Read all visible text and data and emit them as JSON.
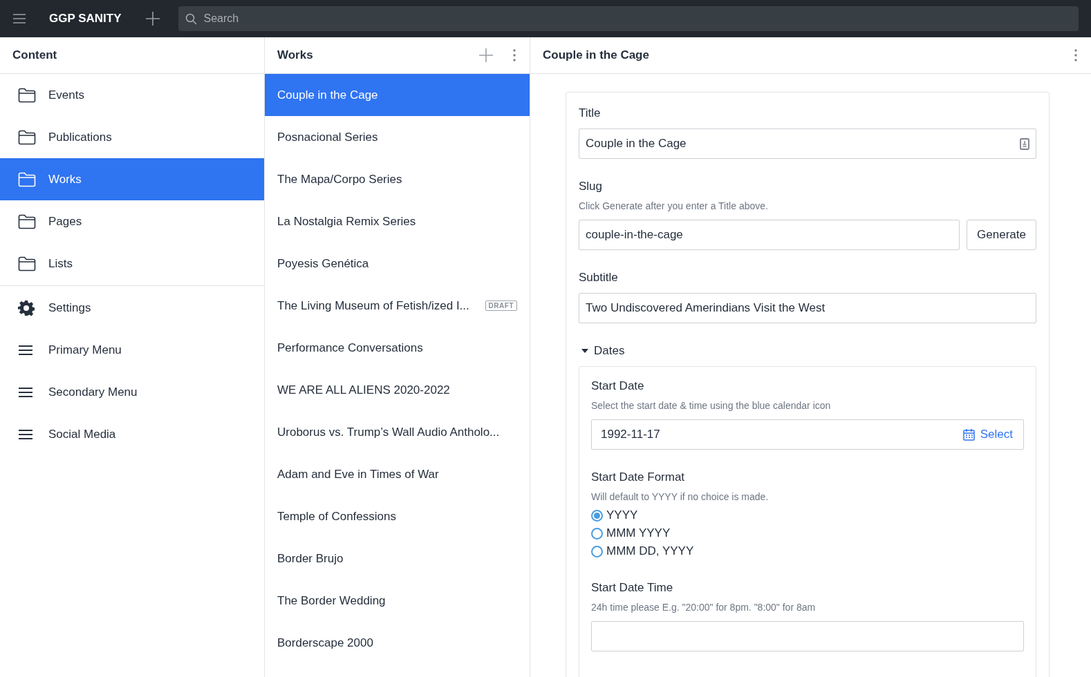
{
  "topbar": {
    "brand": "GGP SANITY",
    "search": {
      "placeholder": "Search"
    }
  },
  "content_pane": {
    "title": "Content",
    "groups": [
      {
        "items": [
          {
            "kind": "folder",
            "label": "Events",
            "selected": false
          },
          {
            "kind": "folder",
            "label": "Publications",
            "selected": false
          },
          {
            "kind": "folder",
            "label": "Works",
            "selected": true
          },
          {
            "kind": "folder",
            "label": "Pages",
            "selected": false
          },
          {
            "kind": "folder",
            "label": "Lists",
            "selected": false
          }
        ]
      },
      {
        "items": [
          {
            "kind": "gear",
            "label": "Settings",
            "selected": false
          },
          {
            "kind": "list",
            "label": "Primary Menu",
            "selected": false
          },
          {
            "kind": "list",
            "label": "Secondary Menu",
            "selected": false
          },
          {
            "kind": "list",
            "label": "Social Media",
            "selected": false
          }
        ]
      }
    ]
  },
  "works_pane": {
    "title": "Works",
    "items": [
      {
        "label": "Couple in the Cage",
        "selected": true
      },
      {
        "label": "Posnacional Series",
        "selected": false
      },
      {
        "label": "The Mapa/Corpo Series",
        "selected": false
      },
      {
        "label": "La Nostalgia Remix Series",
        "selected": false
      },
      {
        "label": "Poyesis Genética",
        "selected": false
      },
      {
        "label": "The Living Museum of Fetish/ized I...",
        "selected": false,
        "badge": "DRAFT"
      },
      {
        "label": "Performance Conversations",
        "selected": false
      },
      {
        "label": "WE ARE ALL ALIENS 2020-2022",
        "selected": false
      },
      {
        "label": "Uroborus vs. Trump’s Wall Audio Antholo...",
        "selected": false
      },
      {
        "label": "Adam and Eve in Times of War",
        "selected": false
      },
      {
        "label": "Temple of Confessions",
        "selected": false
      },
      {
        "label": "Border Brujo",
        "selected": false
      },
      {
        "label": "The Border Wedding",
        "selected": false
      },
      {
        "label": "Borderscape 2000",
        "selected": false
      }
    ]
  },
  "document": {
    "title": "Couple in the Cage",
    "fields": [
      {
        "kind": "title",
        "label": "Title",
        "value": "Couple in the Cage"
      },
      {
        "kind": "slug",
        "label": "Slug",
        "description": "Click Generate after you enter a Title above.",
        "value": "couple-in-the-cage",
        "button": "Generate"
      },
      {
        "kind": "text",
        "label": "Subtitle",
        "value": "Two Undiscovered Amerindians Visit the West"
      },
      {
        "kind": "fieldset",
        "label": "Dates",
        "expanded": true,
        "fields": [
          {
            "kind": "date",
            "label": "Start Date",
            "description": "Select the start date & time using the blue calendar icon",
            "value": "1992-11-17",
            "button": "Select"
          },
          {
            "kind": "radio",
            "label": "Start Date Format",
            "description": "Will default to YYYY if no choice is made.",
            "options": [
              {
                "label": "YYYY",
                "selected": true
              },
              {
                "label": "MMM YYYY",
                "selected": false
              },
              {
                "label": "MMM DD, YYYY",
                "selected": false
              }
            ]
          },
          {
            "kind": "text",
            "label": "Start Date Time",
            "description": "24h time please E.g. \"20:00\" for 8pm. \"8:00\" for 8am"
          }
        ]
      }
    ]
  }
}
